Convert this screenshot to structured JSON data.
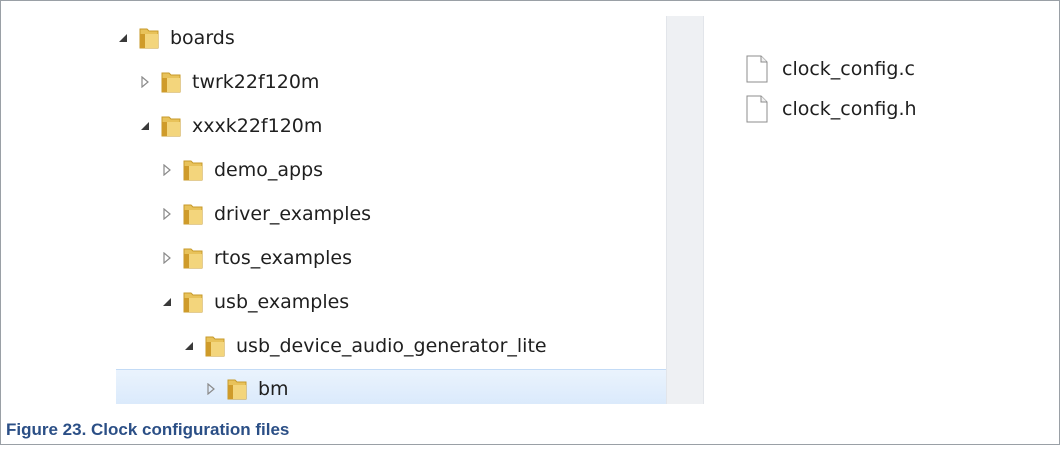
{
  "tree": {
    "items": [
      {
        "label": "boards",
        "state": "expanded"
      },
      {
        "label": "twrk22f120m",
        "state": "collapsed"
      },
      {
        "label": "xxxk22f120m",
        "state": "expanded"
      },
      {
        "label": "demo_apps",
        "state": "collapsed"
      },
      {
        "label": "driver_examples",
        "state": "collapsed"
      },
      {
        "label": "rtos_examples",
        "state": "collapsed"
      },
      {
        "label": "usb_examples",
        "state": "expanded"
      },
      {
        "label": "usb_device_audio_generator_lite",
        "state": "expanded"
      },
      {
        "label": "bm",
        "state": "collapsed",
        "selected": true
      }
    ]
  },
  "files": {
    "items": [
      {
        "name": "clock_config.c"
      },
      {
        "name": "clock_config.h"
      }
    ]
  },
  "caption": {
    "text": "Figure 23.  Clock configuration files"
  },
  "colors": {
    "selection_background": "#d9e9fb",
    "folder_yellow": "#e8c25a",
    "caption_blue": "#2b4f86"
  },
  "icons": {
    "folder": "folder-icon",
    "file": "file-icon",
    "expanded": "expanded-triangle-icon",
    "collapsed": "collapsed-triangle-icon"
  }
}
